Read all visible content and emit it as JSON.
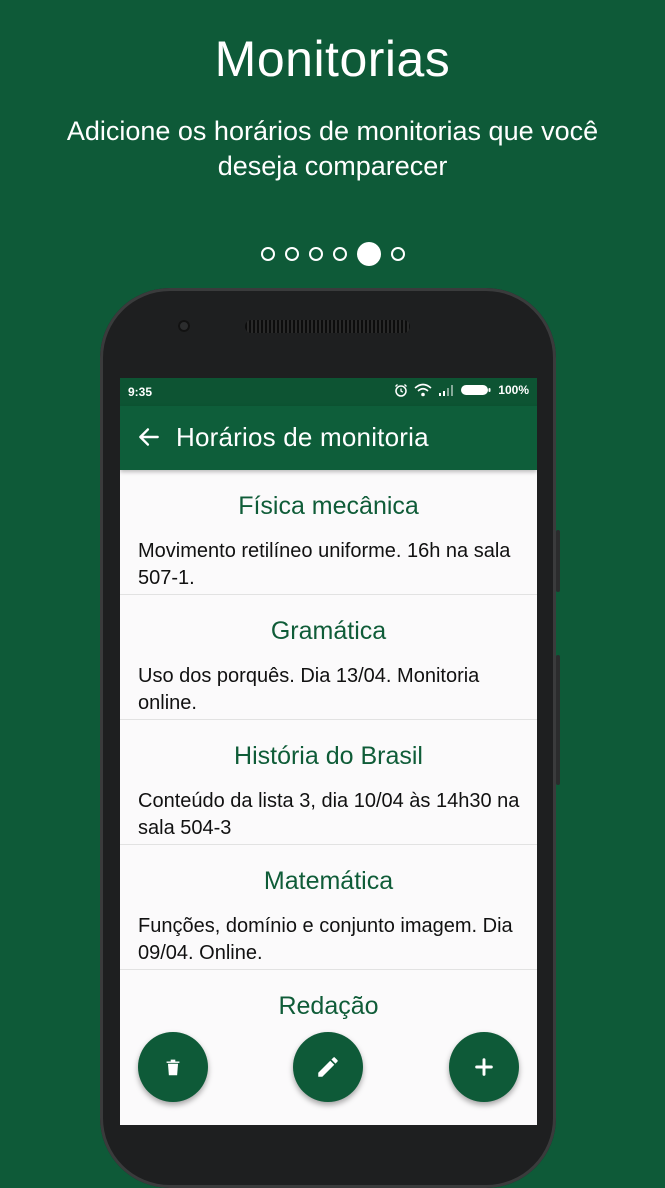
{
  "hero": {
    "title": "Monitorias",
    "subtitle": "Adicione os horários de monitorias que você deseja comparecer"
  },
  "pager": {
    "count": 6,
    "active_index": 4
  },
  "status_bar": {
    "time": "9:35",
    "battery": "100%"
  },
  "app_bar": {
    "title": "Horários de monitoria",
    "back_icon": "arrow-back-icon"
  },
  "items": [
    {
      "subject": "Física mecânica",
      "description": "Movimento retilíneo uniforme. 16h na sala 507-1."
    },
    {
      "subject": "Gramática",
      "description": "Uso dos porquês. Dia 13/04. Monitoria online."
    },
    {
      "subject": "História do Brasil",
      "description": "Conteúdo da lista 3, dia 10/04 às 14h30 na sala 504-3"
    },
    {
      "subject": "Matemática",
      "description": "Funções, domínio e conjunto imagem. Dia 09/04. Online."
    },
    {
      "subject": "Redação",
      "description": ""
    }
  ],
  "fabs": {
    "delete_icon": "trash-icon",
    "edit_icon": "pencil-icon",
    "add_icon": "plus-icon"
  },
  "colors": {
    "background": "#0e5a38",
    "app_bar": "#0e5e3a",
    "status_bar": "#0d5433",
    "accent_text": "#0f5c38"
  }
}
